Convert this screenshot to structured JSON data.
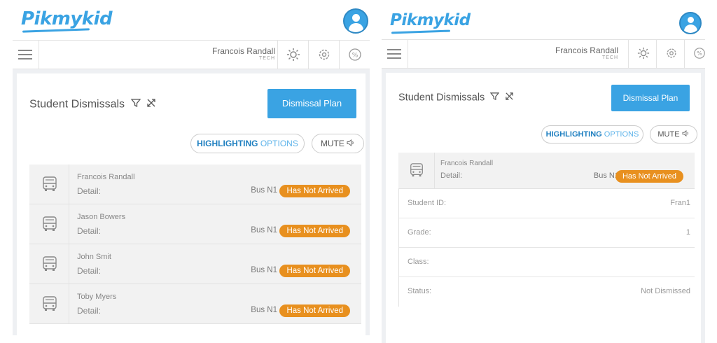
{
  "brand": {
    "name": "Pikmykid",
    "color": "#3aa3e3"
  },
  "topbar": {
    "user_name": "Francois Randall",
    "user_role": "TECH",
    "icons": [
      "sun-icon",
      "gear-icon",
      "percent-icon"
    ]
  },
  "left": {
    "heading": "Student Dismissals",
    "dismissal_button": "Dismissal Plan",
    "highlight_word1": "HIGHLIGHTING",
    "highlight_word2": "OPTIONS",
    "mute_label": "MUTE",
    "students": [
      {
        "name": "Francois Randall",
        "detail_label": "Detail:",
        "bus": "Bus N1",
        "status": "Has Not Arrived"
      },
      {
        "name": "Jason Bowers",
        "detail_label": "Detail:",
        "bus": "Bus N1",
        "status": "Has Not Arrived"
      },
      {
        "name": "John Smit",
        "detail_label": "Detail:",
        "bus": "Bus N1",
        "status": "Has Not Arrived"
      },
      {
        "name": "Toby Myers",
        "detail_label": "Detail:",
        "bus": "Bus N1",
        "status": "Has Not Arrived"
      }
    ]
  },
  "right": {
    "heading": "Student Dismissals",
    "dismissal_button": "Dismissal Plan",
    "highlight_word1": "HIGHLIGHTING",
    "highlight_word2": "OPTIONS",
    "mute_label": "MUTE",
    "student": {
      "name": "Francois Randall",
      "detail_label": "Detail:",
      "bus": "Bus N1",
      "status": "Has Not Arrived"
    },
    "details": [
      {
        "label": "Student ID:",
        "value": "Fran1"
      },
      {
        "label": "Grade:",
        "value": "1"
      },
      {
        "label": "Class:",
        "value": ""
      },
      {
        "label": "Status:",
        "value": "Not Dismissed"
      }
    ]
  },
  "colors": {
    "accent": "#3aa3e3",
    "badge": "#e8901f",
    "row_bg": "#f2f2f2"
  }
}
